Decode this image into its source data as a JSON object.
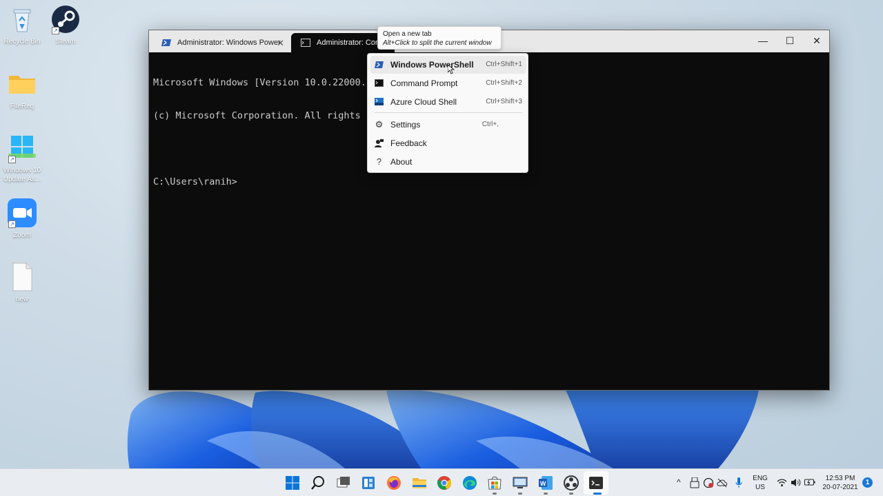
{
  "desktop": {
    "icons": [
      {
        "label": "Recycle Bin",
        "icon": "recycle-bin-icon"
      },
      {
        "label": "Steam",
        "icon": "steam-icon"
      },
      {
        "label": "FileReq",
        "icon": "folder-icon"
      },
      {
        "label": "Windows 10 Update As...",
        "icon": "windows-update-icon"
      },
      {
        "label": "Zoom",
        "icon": "zoom-icon"
      },
      {
        "label": "new",
        "icon": "text-file-icon"
      }
    ]
  },
  "terminal": {
    "tabs": [
      {
        "label": "Administrator: Windows Power",
        "icon": "powershell-icon",
        "active": false
      },
      {
        "label": "Administrator: Comm",
        "icon": "cmd-icon",
        "active": true
      }
    ],
    "controls": {
      "minimize": "—",
      "maximize": "☐",
      "close": "✕"
    },
    "lines": [
      "Microsoft Windows [Version 10.0.22000.7",
      "(c) Microsoft Corporation. All rights r",
      "",
      "C:\\Users\\ranih>"
    ]
  },
  "tooltip": {
    "title": "Open a new tab",
    "hint": "Alt+Click to split the current window"
  },
  "dropdown": {
    "profiles": [
      {
        "label": "Windows PowerShell",
        "shortcut": "Ctrl+Shift+1",
        "icon": "powershell-icon"
      },
      {
        "label": "Command Prompt",
        "shortcut": "Ctrl+Shift+2",
        "icon": "cmd-icon"
      },
      {
        "label": "Azure Cloud Shell",
        "shortcut": "Ctrl+Shift+3",
        "icon": "azure-icon"
      }
    ],
    "actions": [
      {
        "label": "Settings",
        "shortcut": "Ctrl+,",
        "icon": "gear-icon"
      },
      {
        "label": "Feedback",
        "shortcut": "",
        "icon": "feedback-icon"
      },
      {
        "label": "About",
        "shortcut": "",
        "icon": "question-icon"
      }
    ]
  },
  "taskbar": {
    "pinned": [
      "windows-start-icon",
      "search-icon",
      "task-view-icon",
      "widgets-icon",
      "firefox-icon",
      "file-explorer-icon",
      "chrome-icon",
      "edge-icon",
      "store-icon",
      "remote-desktop-icon",
      "word-icon",
      "obs-icon",
      "terminal-icon"
    ],
    "language": {
      "line1": "ENG",
      "line2": "US"
    },
    "clock": {
      "time": "12:53 PM",
      "date": "20-07-2021"
    },
    "notifications": "1"
  },
  "colors": {
    "accent": "#0078d4",
    "terminal_bg": "#0c0c0c",
    "terminal_text": "#cccccc",
    "menu_bg": "#f9f9f9"
  }
}
